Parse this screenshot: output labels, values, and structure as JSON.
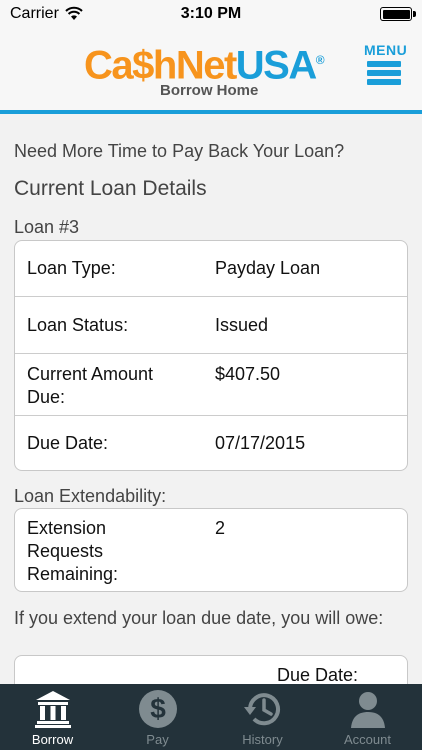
{
  "status_bar": {
    "carrier": "Carrier",
    "time": "3:10 PM"
  },
  "header": {
    "logo": {
      "part1": "Ca",
      "dollar": "$",
      "part2": "hNet",
      "part3": "USA",
      "reg": "®"
    },
    "subtitle": "Borrow Home",
    "menu_label": "MENU"
  },
  "content": {
    "question": "Need More Time to Pay Back Your Loan?",
    "section_title": "Current Loan Details",
    "loan_number": "Loan #3",
    "details": [
      {
        "label": "Loan Type:",
        "value": "Payday Loan"
      },
      {
        "label": "Loan Status:",
        "value": "Issued"
      },
      {
        "label": "Current Amount Due:",
        "value": "$407.50"
      },
      {
        "label": "Due Date:",
        "value": "07/17/2015"
      }
    ],
    "extendability_label": "Loan Extendability:",
    "extension": {
      "label": "Extension Requests Remaining:",
      "value": "2"
    },
    "extend_note": "If you extend your loan due date, you will owe:",
    "owe_due_date_label": "Due Date:"
  },
  "tabbar": {
    "tabs": [
      {
        "label": "Borrow",
        "icon": "bank-icon",
        "active": true
      },
      {
        "label": "Pay",
        "icon": "dollar-icon",
        "active": false
      },
      {
        "label": "History",
        "icon": "history-icon",
        "active": false
      },
      {
        "label": "Account",
        "icon": "person-icon",
        "active": false
      }
    ]
  },
  "colors": {
    "brand_orange": "#f7941d",
    "brand_blue": "#1a9ed9",
    "tabbar_bg": "#23323a",
    "tab_inactive": "#7f8b90",
    "tab_active": "#ffffff"
  }
}
